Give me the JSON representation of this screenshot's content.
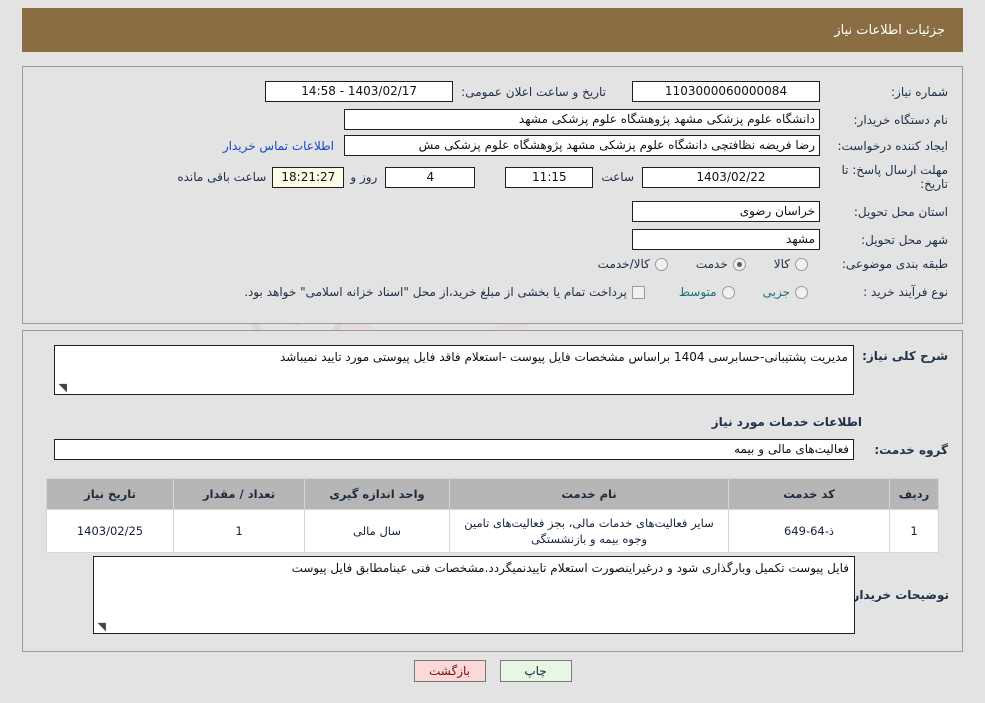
{
  "header": {
    "title": "جزئیات اطلاعات نیاز",
    "bar_color": "#8a6d42"
  },
  "main_form": {
    "need_number_label": "شماره نیاز:",
    "need_number_value": "1103000060000084",
    "announce_label": "تاریخ و ساعت اعلان عمومی:",
    "announce_value": "1403/02/17 - 14:58",
    "buyer_org_label": "نام دستگاه خریدار:",
    "buyer_org_value": "دانشگاه علوم پزشکی مشهد   پژوهشگاه علوم پزشکی مشهد",
    "creator_label": "ایجاد کننده درخواست:",
    "creator_value": "رضا فریضه نظافتچی دانشگاه علوم پزشکی مشهد   پژوهشگاه علوم پزشکی مش",
    "contact_link": "اطلاعات تماس خریدار",
    "deadline_label": "مهلت ارسال پاسخ: تا تاریخ:",
    "deadline_date": "1403/02/22",
    "hour_label": "ساعت",
    "deadline_time": "11:15",
    "days_value": "4",
    "days_label": "روز و",
    "countdown_value": "18:21:27",
    "countdown_label": "ساعت باقی مانده",
    "province_label": "استان محل تحویل:",
    "province_value": "خراسان رضوی",
    "city_label": "شهر محل تحویل:",
    "city_value": "مشهد",
    "category_label": "طبقه بندی موضوعی:",
    "category_options": [
      {
        "label": "کالا",
        "selected": false
      },
      {
        "label": "خدمت",
        "selected": true
      },
      {
        "label": "کالا/خدمت",
        "selected": false
      }
    ],
    "process_label": "نوع فرآیند خرید :",
    "process_options": [
      {
        "label": "جزیی",
        "selected": false
      },
      {
        "label": "متوسط",
        "selected": false
      }
    ],
    "treasury_checkbox_label": "پرداخت تمام یا بخشی از مبلغ خرید،از محل \"اسناد خزانه اسلامی\" خواهد بود.",
    "treasury_checked": false
  },
  "detail": {
    "summary_label": "شرح کلی نیاز:",
    "summary_value": "مدیریت پشتیبانی-حسابرسی 1404 براساس مشخصات فایل پیوست -استعلام فاقد فایل پیوستی مورد تایید نمیباشد",
    "services_heading": "اطلاعات خدمات مورد نیاز",
    "service_group_label": "گروه خدمت:",
    "service_group_value": "فعالیت‌های مالی و بیمه",
    "buyer_notes_label": "توضیحات خریدار:",
    "buyer_notes_value": "فایل پیوست تکمیل وبارگذاری شود و درغیراینصورت استعلام تاییدنمیگردد.مشخصات فنی عینامطابق فایل پیوست"
  },
  "table": {
    "columns": [
      "ردیف",
      "کد خدمت",
      "نام خدمت",
      "واحد اندازه گیری",
      "تعداد / مقدار",
      "تاریخ نیاز"
    ],
    "rows": [
      {
        "index": "1",
        "code": "ذ-64-649",
        "name": "سایر فعالیت‌های خدمات مالی، بجز فعالیت‌های تامین وجوه بیمه و بازنشستگی",
        "unit": "سال مالی",
        "qty": "1",
        "date": "1403/02/25"
      }
    ]
  },
  "buttons": {
    "print": "چاپ",
    "back": "بازگشت"
  },
  "watermark": {
    "text": "AriaTender.net"
  }
}
